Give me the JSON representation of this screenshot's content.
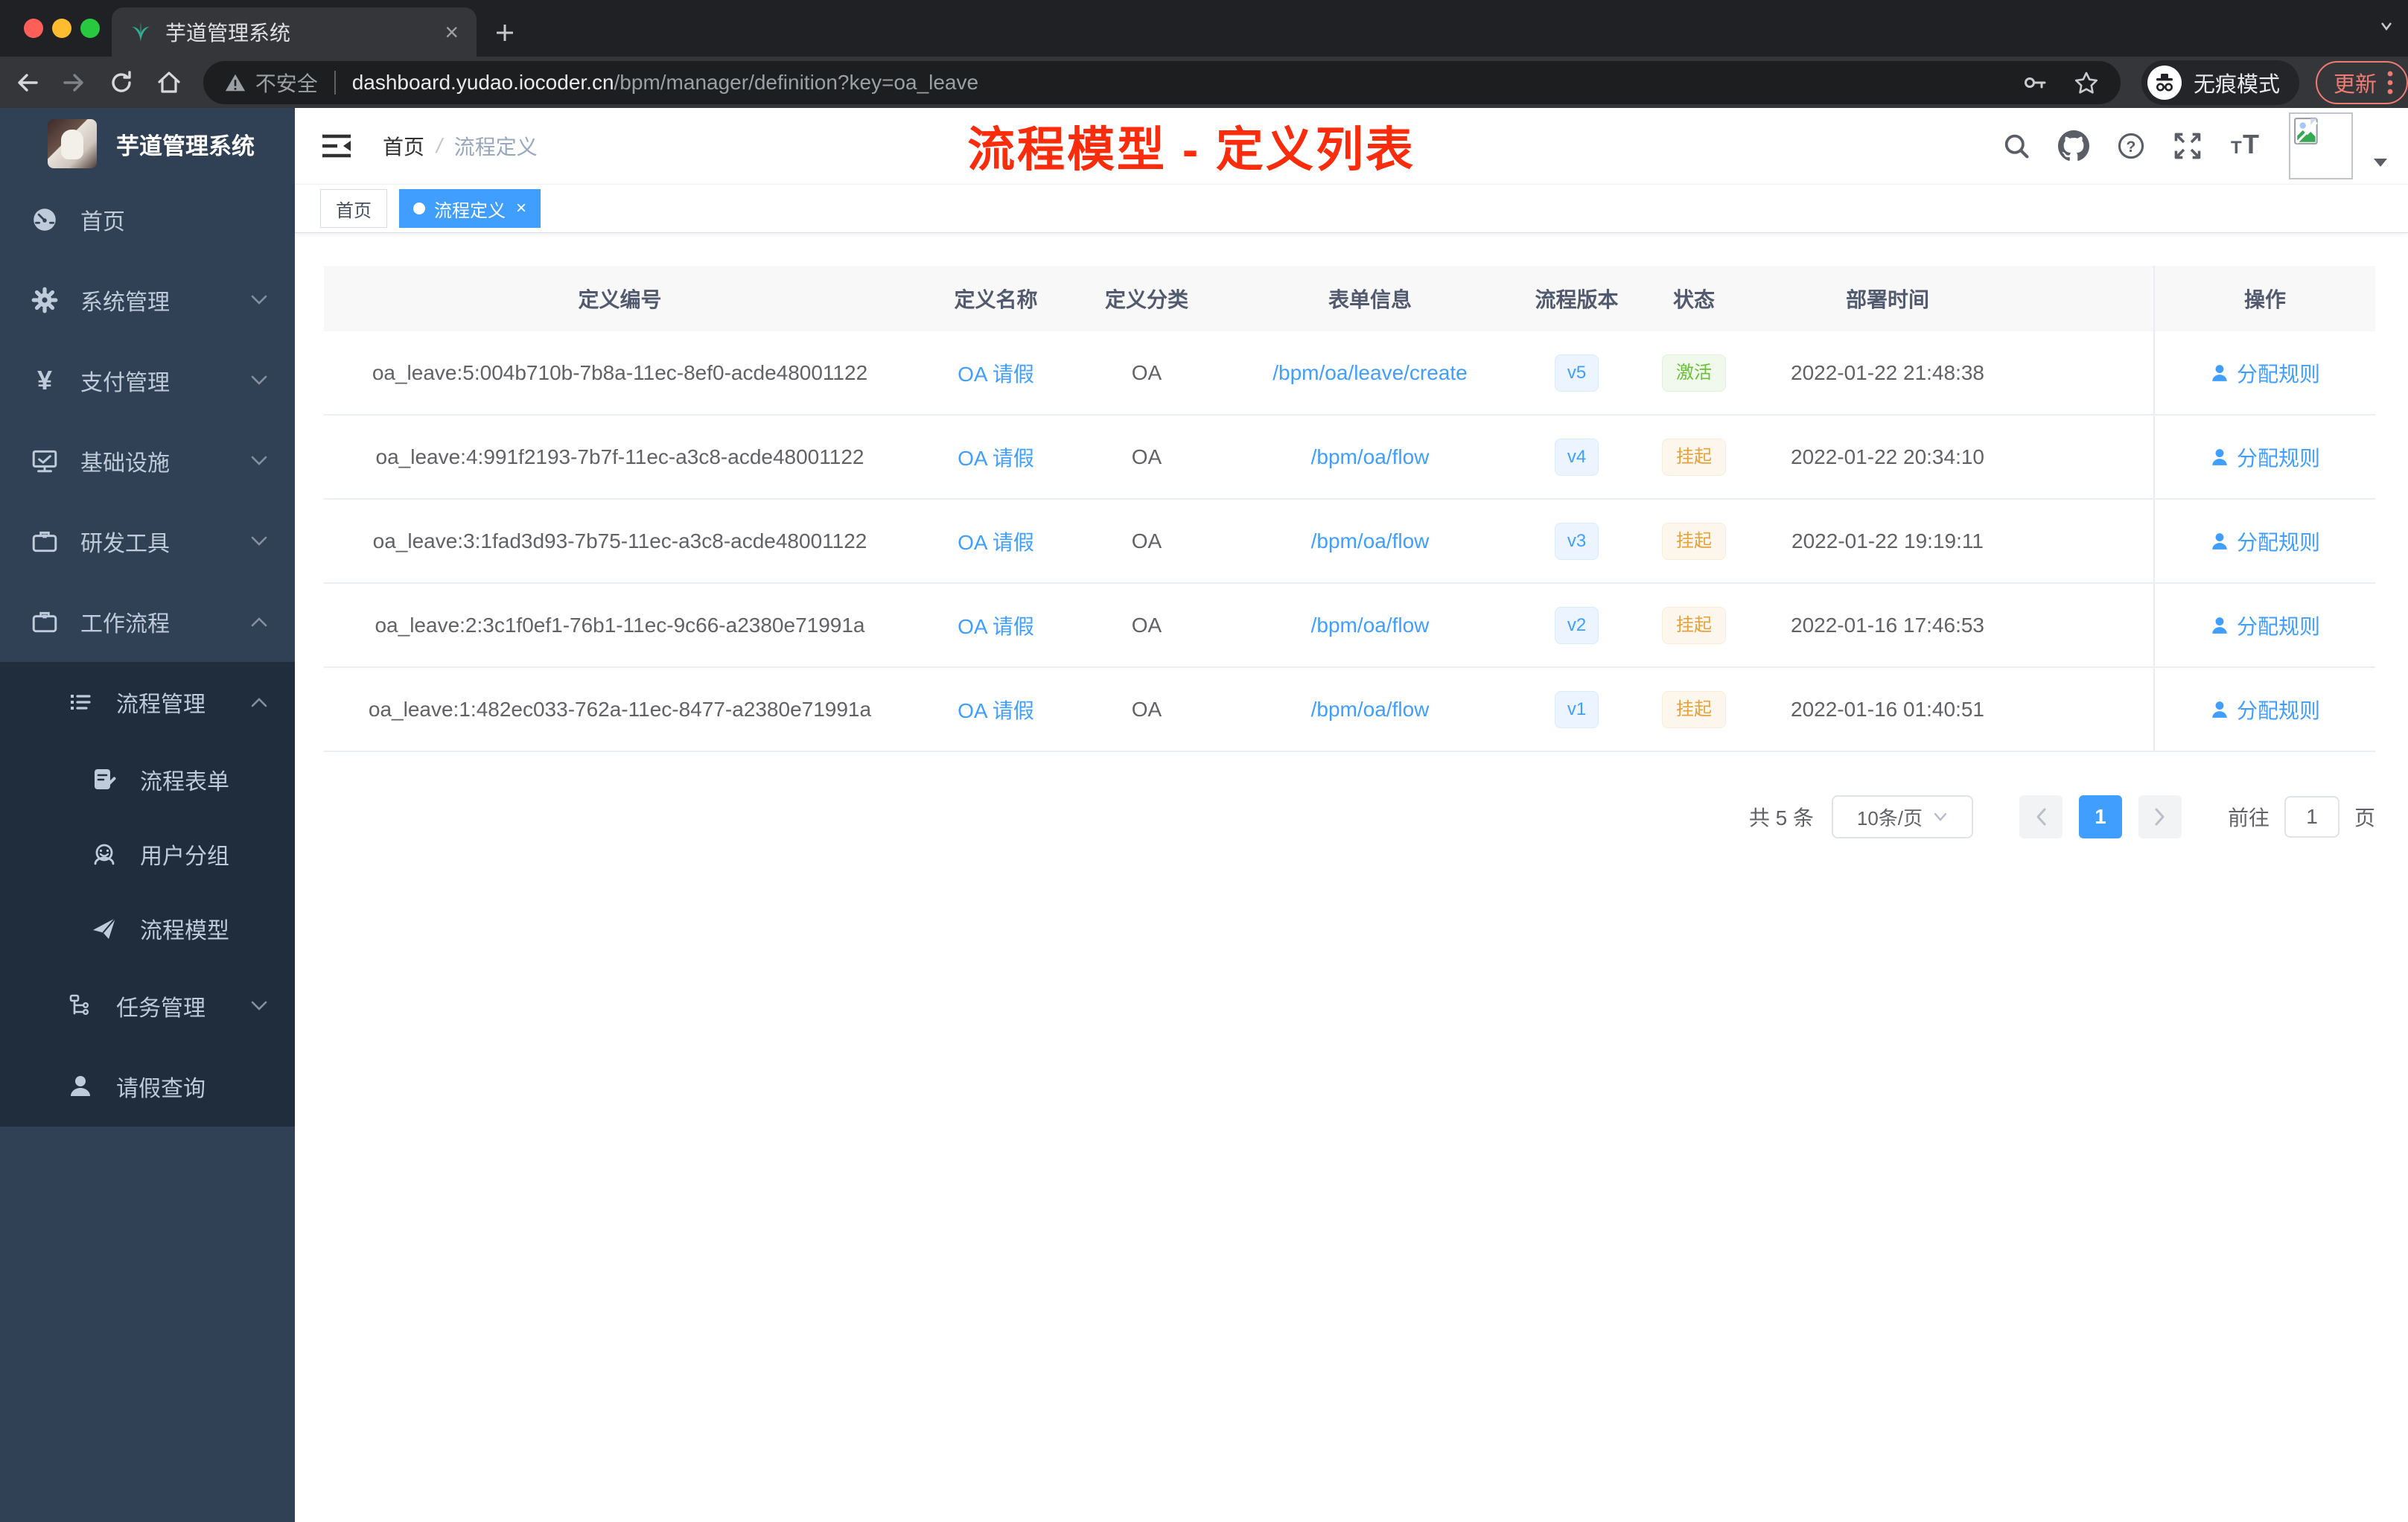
{
  "colors": {
    "accent": "#409eff",
    "success": "#67c23a",
    "warning": "#e6a23c",
    "annotation_red": "#fa2c0c",
    "sidebar_bg": "#304156",
    "submenu_bg": "#1f2d3d"
  },
  "browser": {
    "tab_title": "芋道管理系统",
    "security_label": "不安全",
    "url_host": "dashboard.yudao.iocoder.cn",
    "url_path": "/bpm/manager/definition?key=oa_leave",
    "incognito_label": "无痕模式",
    "update_label": "更新"
  },
  "sidebar": {
    "logo_title": "芋道管理系统",
    "items": [
      {
        "label": "首页"
      },
      {
        "label": "系统管理"
      },
      {
        "label": "支付管理"
      },
      {
        "label": "基础设施"
      },
      {
        "label": "研发工具"
      },
      {
        "label": "工作流程"
      },
      {
        "label": "流程管理"
      },
      {
        "label": "流程表单"
      },
      {
        "label": "用户分组"
      },
      {
        "label": "流程模型"
      },
      {
        "label": "任务管理"
      },
      {
        "label": "请假查询"
      }
    ]
  },
  "header": {
    "breadcrumb_home": "首页",
    "breadcrumb_sep": "/",
    "breadcrumb_current": "流程定义",
    "annotation": "流程模型 - 定义列表"
  },
  "tags": [
    {
      "label": "首页"
    },
    {
      "label": "流程定义",
      "close": "×"
    }
  ],
  "table": {
    "columns": [
      "定义编号",
      "定义名称",
      "定义分类",
      "表单信息",
      "流程版本",
      "状态",
      "部署时间",
      "操作"
    ],
    "rows": [
      {
        "id": "oa_leave:5:004b710b-7b8a-11ec-8ef0-acde48001122",
        "name": "OA 请假",
        "category": "OA",
        "form": "/bpm/oa/leave/create",
        "version": "v5",
        "status": "激活",
        "time": "2022-01-22 21:48:38",
        "action": "分配规则"
      },
      {
        "id": "oa_leave:4:991f2193-7b7f-11ec-a3c8-acde48001122",
        "name": "OA 请假",
        "category": "OA",
        "form": "/bpm/oa/flow",
        "version": "v4",
        "status": "挂起",
        "time": "2022-01-22 20:34:10",
        "action": "分配规则"
      },
      {
        "id": "oa_leave:3:1fad3d93-7b75-11ec-a3c8-acde48001122",
        "name": "OA 请假",
        "category": "OA",
        "form": "/bpm/oa/flow",
        "version": "v3",
        "status": "挂起",
        "time": "2022-01-22 19:19:11",
        "action": "分配规则"
      },
      {
        "id": "oa_leave:2:3c1f0ef1-76b1-11ec-9c66-a2380e71991a",
        "name": "OA 请假",
        "category": "OA",
        "form": "/bpm/oa/flow",
        "version": "v2",
        "status": "挂起",
        "time": "2022-01-16 17:46:53",
        "action": "分配规则"
      },
      {
        "id": "oa_leave:1:482ec033-762a-11ec-8477-a2380e71991a",
        "name": "OA 请假",
        "category": "OA",
        "form": "/bpm/oa/flow",
        "version": "v1",
        "status": "挂起",
        "time": "2022-01-16 01:40:51",
        "action": "分配规则"
      }
    ]
  },
  "pagination": {
    "total_label": "共 5 条",
    "page_size_label": "10条/页",
    "current_page": "1",
    "goto_label": "前往",
    "page_unit": "页"
  }
}
